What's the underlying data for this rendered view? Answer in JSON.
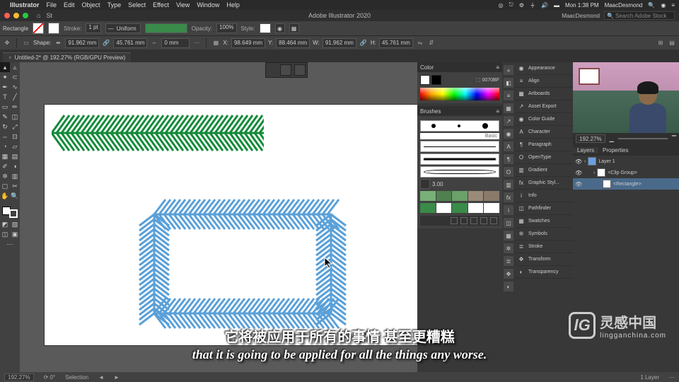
{
  "os_menu": {
    "app": "Illustrator",
    "items": [
      "File",
      "Edit",
      "Object",
      "Type",
      "Select",
      "Effect",
      "View",
      "Window",
      "Help"
    ],
    "right": {
      "time": "Mon 1:38 PM",
      "user": "MaacDesmond"
    }
  },
  "titlebar": {
    "title": "Adobe Illustrator 2020",
    "workspace": "MaacDesmond",
    "search_placeholder": "Search Adobe Stock"
  },
  "controlbar": {
    "shape": "Rectangle",
    "stroke_label": "Stroke:",
    "stroke_pt": "1 pt",
    "uniform": "Uniform",
    "opacity_label": "Opacity:",
    "opacity": "100%",
    "style_label": "Style:"
  },
  "propbar": {
    "shape_label": "Shape:",
    "w": "91.962 mm",
    "h": "45.761 mm",
    "r": "0 mm",
    "x": "98.649 mm",
    "y": "88.464 mm",
    "w2": "91.962 mm",
    "h2": "45.761 mm"
  },
  "document_tab": "Untitled-2* @ 192.27% (RGB/GPU Preview)",
  "panels": {
    "color": {
      "title": "Color",
      "hex": "0070BF"
    },
    "brushes": {
      "title": "Brushes",
      "basic": "Basic",
      "size": "3.00"
    },
    "left_list": [
      "Appearance",
      "Align",
      "Artboards",
      "Asset Export",
      "Color Guide",
      "Character",
      "Paragraph",
      "OpenType",
      "Gradient",
      "Graphic Styl...",
      "Info",
      "Pathfinder",
      "Swatches",
      "Symbols",
      "Stroke",
      "Transform",
      "Transparency"
    ]
  },
  "navigator": {
    "zoom": "192.27%"
  },
  "layers": {
    "tabs": [
      "Layers",
      "Properties"
    ],
    "items": [
      {
        "name": "Layer 1",
        "color": "#6aa0e0"
      },
      {
        "name": "<Clip Group>",
        "indent": 1
      },
      {
        "name": "<Rectangle>",
        "indent": 2,
        "sel": true
      }
    ]
  },
  "statusbar": {
    "zoom": "192.27%",
    "tool": "Selection",
    "layer": "1 Layer"
  },
  "subtitle": {
    "cn": "它将被应用于所有的事情 甚至更糟糕",
    "en": "that it is going to be applied for all the things any worse."
  },
  "watermark": {
    "t1": "灵感中国",
    "t2": "lingganchina.com"
  }
}
